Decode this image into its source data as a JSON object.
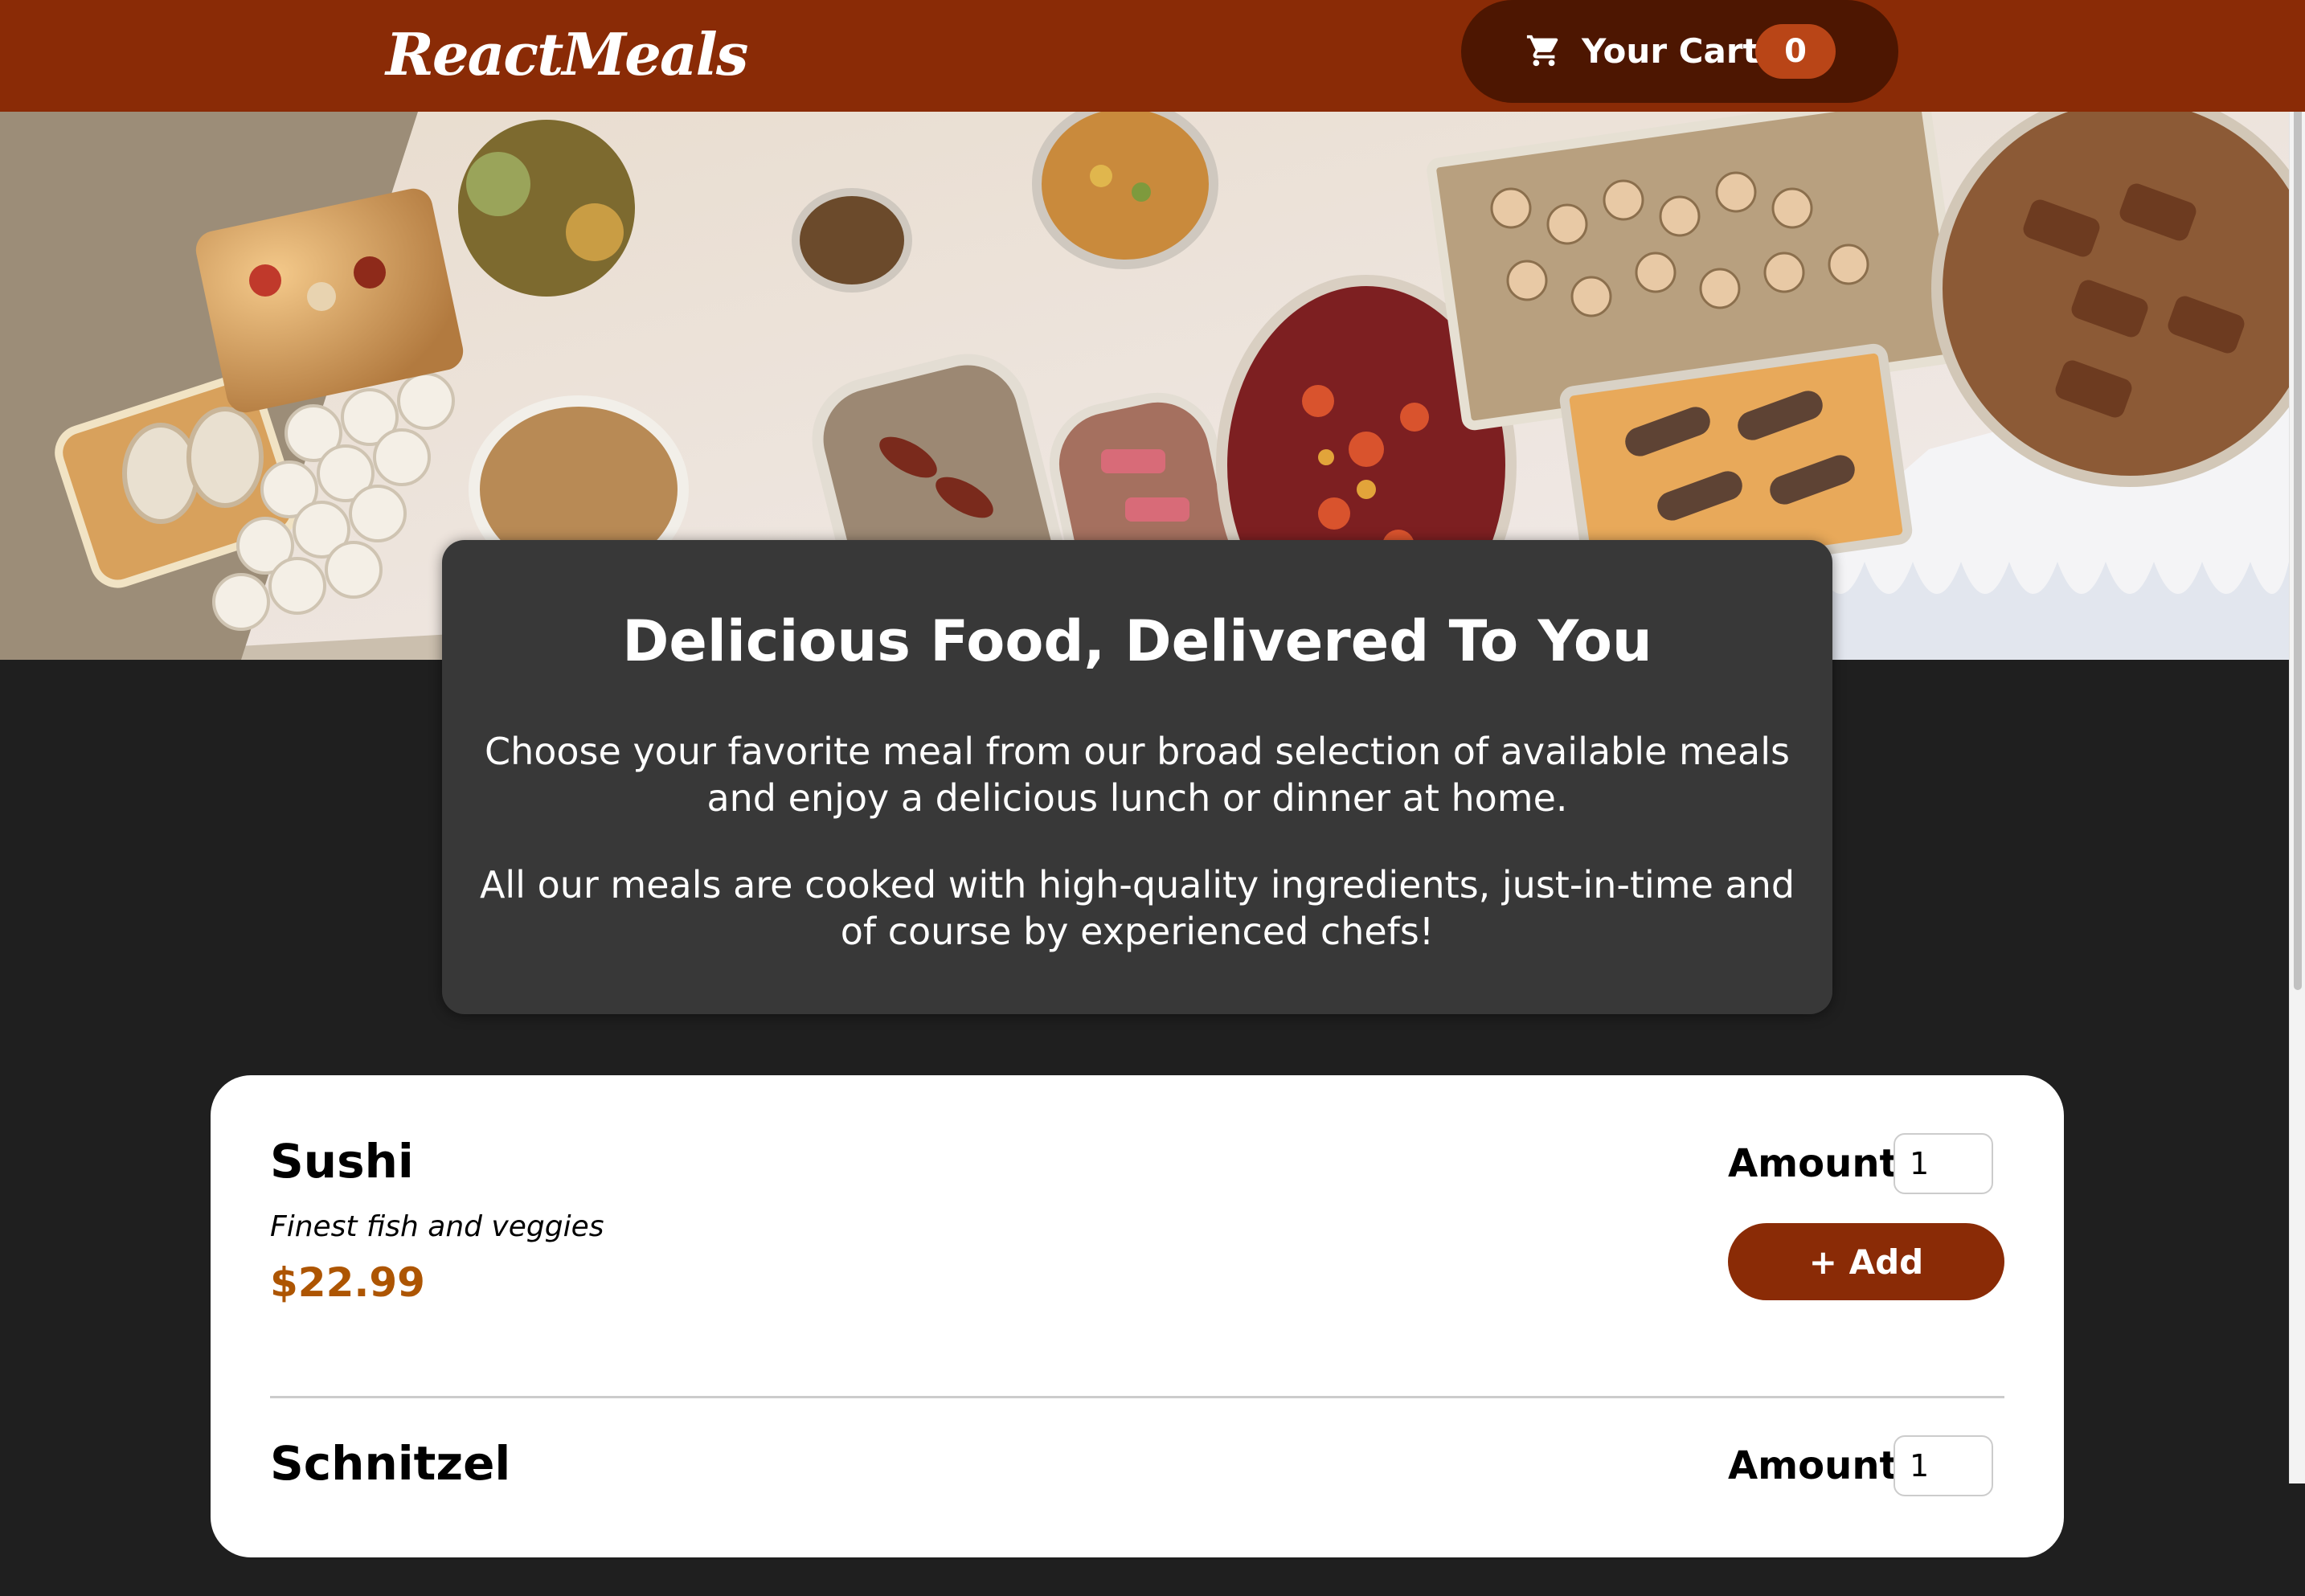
{
  "header": {
    "logo_text": "ReactMeals",
    "cart": {
      "label": "Your Cart",
      "count": "0",
      "icon": "cart-icon"
    }
  },
  "hero": {
    "image": "buffet-table-photo"
  },
  "summary": {
    "title": "Delicious Food, Delivered To You",
    "paragraph1": "Choose your favorite meal from our broad selection of available meals and enjoy a delicious lunch or dinner at home.",
    "paragraph2": "All our meals are cooked with high-quality ingredients, just-in-time and of course by experienced chefs!"
  },
  "meals": [
    {
      "name": "Sushi",
      "description": "Finest fish and veggies",
      "price": "$22.99",
      "amount_label": "Amount",
      "amount_value": "1",
      "add_label": "+ Add"
    },
    {
      "name": "Schnitzel",
      "amount_label": "Amount",
      "amount_value": "1"
    }
  ],
  "colors": {
    "header_bg": "#8a2b06",
    "cart_bg": "#4d1601",
    "badge_bg": "#b94517",
    "price": "#ad5502",
    "page_bg": "#1f1f1f",
    "summary_bg": "#383838"
  }
}
